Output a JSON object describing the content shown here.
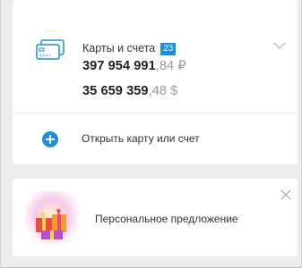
{
  "accounts": {
    "title": "Карты и счета",
    "count": "23",
    "balances": [
      {
        "integer": "397 954 991",
        "fraction": ",84 ₽"
      },
      {
        "integer": "35 659 359",
        "fraction": ",48 $"
      }
    ],
    "open_label": "Открыть карту или счет",
    "icon": "cards-icon",
    "accent_color": "#1a8fe3"
  },
  "offer": {
    "label": "Персональное предложение",
    "icon": "gift-icon"
  }
}
